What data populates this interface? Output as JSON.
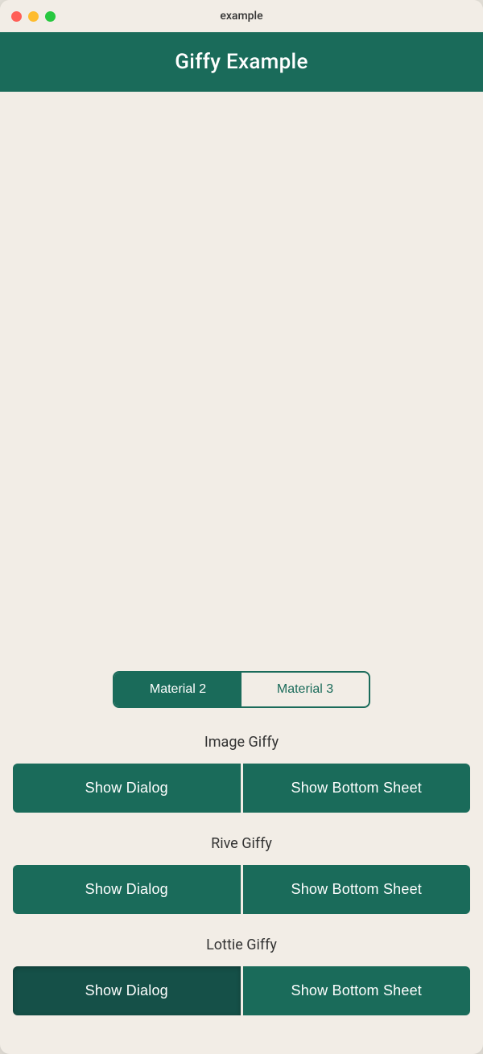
{
  "window": {
    "title": "example"
  },
  "header": {
    "title": "Giffy Example"
  },
  "tabs": [
    {
      "label": "Material 2",
      "active": true
    },
    {
      "label": "Material 3",
      "active": false
    }
  ],
  "sections": [
    {
      "title": "Image Giffy",
      "btn_dialog": "Show Dialog",
      "btn_sheet": "Show Bottom Sheet"
    },
    {
      "title": "Rive Giffy",
      "btn_dialog": "Show Dialog",
      "btn_sheet": "Show Bottom Sheet"
    },
    {
      "title": "Lottie Giffy",
      "btn_dialog": "Show Dialog",
      "btn_sheet": "Show Bottom Sheet"
    }
  ],
  "colors": {
    "primary": "#1a6b5a",
    "primary_dark": "#155048",
    "background": "#f2ede6",
    "text_white": "#ffffff",
    "text_dark": "#333333"
  }
}
